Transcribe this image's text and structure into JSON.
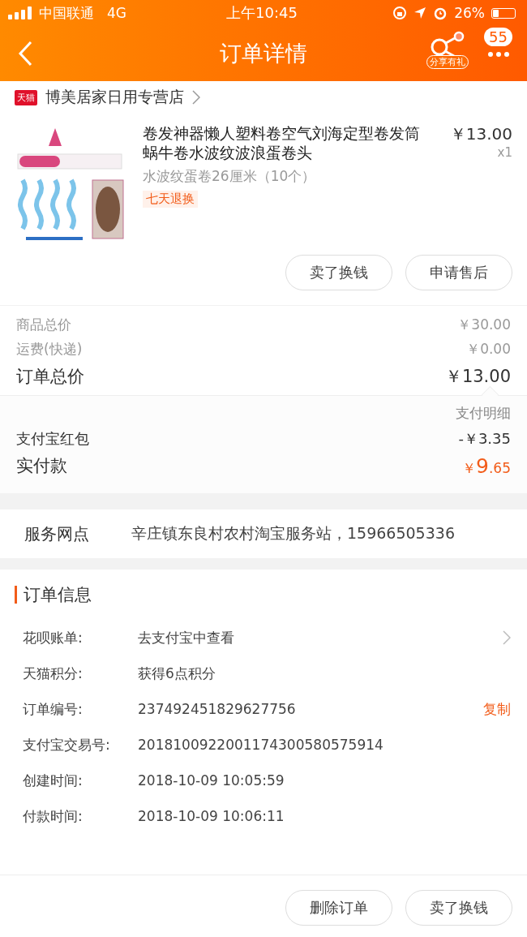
{
  "status_bar": {
    "carrier": "中国联通",
    "network": "4G",
    "time": "上午10:45",
    "battery": "26%"
  },
  "nav": {
    "title": "订单详情",
    "share_label": "分享有礼",
    "badge": "55"
  },
  "shop": {
    "tag": "天猫",
    "name": "博美居家日用专营店"
  },
  "product": {
    "title": "卷发神器懒人塑料卷空气刘海定型卷发筒蜗牛卷水波纹波浪蛋卷头",
    "sku": "水波纹蛋卷26厘米（10个）",
    "tag": "七天退换",
    "price": "￥13.00",
    "quantity": "x1"
  },
  "product_buttons": [
    "卖了换钱",
    "申请售后"
  ],
  "summary": [
    {
      "label": "商品总价",
      "value": "￥30.00",
      "kind": "minor"
    },
    {
      "label": "运费(快递)",
      "value": "￥0.00",
      "kind": "minor"
    },
    {
      "label": "订单总价",
      "value": "￥13.00",
      "kind": "major"
    }
  ],
  "payment": {
    "detail_link": "支付明细",
    "rows": [
      {
        "label": "支付宝红包",
        "value": "-￥3.35",
        "kind": "minor"
      },
      {
        "label": "实付款",
        "value_symbol": "￥",
        "value_int": "9",
        "value_dec": ".65",
        "kind": "total"
      }
    ]
  },
  "service": {
    "label": "服务网点",
    "value": "辛庄镇东良村农村淘宝服务站，15966505336"
  },
  "order_info": {
    "title": "订单信息",
    "rows": [
      {
        "label": "花呗账单:",
        "value": "去支付宝中查看",
        "link": true
      },
      {
        "label": "天猫积分:",
        "value": "获得6点积分"
      },
      {
        "label": "订单编号:",
        "value": "237492451829627756",
        "action": "复制"
      },
      {
        "label": "支付宝交易号:",
        "value": "2018100922001174300580575914"
      },
      {
        "label": "创建时间:",
        "value": "2018-10-09 10:05:59"
      },
      {
        "label": "付款时间:",
        "value": "2018-10-09 10:06:11"
      }
    ]
  },
  "bottom_buttons": [
    "删除订单",
    "卖了换钱"
  ]
}
